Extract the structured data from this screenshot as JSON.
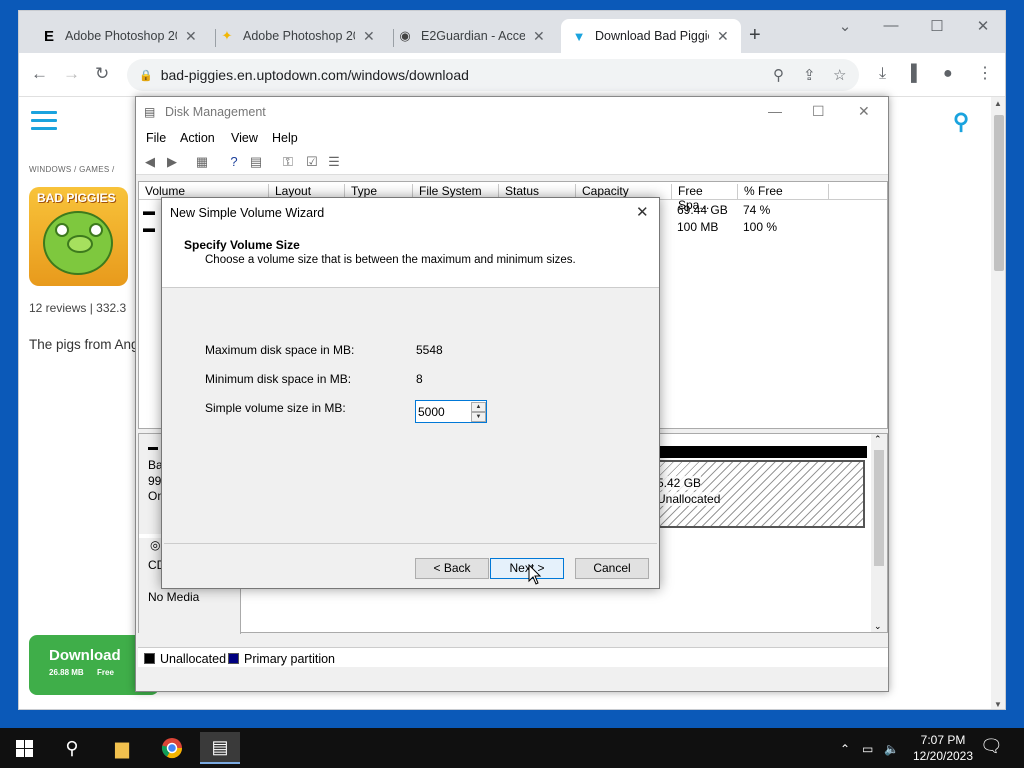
{
  "browser": {
    "tabs": [
      {
        "label": "Adobe Photoshop 20",
        "icon": "tech-site-icon"
      },
      {
        "label": "Adobe Photoshop 20",
        "icon": "photoshop-app-icon"
      },
      {
        "label": "E2Guardian - Access",
        "icon": "globe-icon"
      },
      {
        "label": "Download Bad Piggie",
        "icon": "uptodown-icon"
      }
    ],
    "url": "bad-piggies.en.uptodown.com/windows/download"
  },
  "page": {
    "breadcrumb": "WINDOWS  /  GAMES  /",
    "app_logo_text": "BAD PIGGIES",
    "reviews": "12 reviews  |  332.3",
    "description": "The pigs from Ang",
    "download_label": "Download",
    "download_size": "26.88 MB",
    "download_free": "Free",
    "footer_text": ""
  },
  "disk_management": {
    "title": "Disk Management",
    "menu": [
      "File",
      "Action",
      "View",
      "Help"
    ],
    "columns": [
      "Volume",
      "Layout",
      "Type",
      "File System",
      "Status",
      "Capacity",
      "Free Spa...",
      "% Free"
    ],
    "rows": [
      {
        "free": "69.44 GB",
        "pct": "74 %"
      },
      {
        "free": "100 MB",
        "pct": "100 %"
      }
    ],
    "disk0": {
      "line1": "Ba",
      "line2": "99.",
      "line3": "On"
    },
    "cd": {
      "label": "CD",
      "media": "No Media"
    },
    "unallocated": {
      "size": "5.42 GB",
      "label": "Unallocated"
    },
    "legend": [
      {
        "label": "Unallocated",
        "color": "#000000"
      },
      {
        "label": "Primary partition",
        "color": "#000080"
      }
    ]
  },
  "wizard": {
    "title": "New Simple Volume Wizard",
    "heading": "Specify Volume Size",
    "subheading": "Choose a volume size that is between the maximum and minimum sizes.",
    "max_label": "Maximum disk space in MB:",
    "max_value": "5548",
    "min_label": "Minimum disk space in MB:",
    "min_value": "8",
    "size_label": "Simple volume size in MB:",
    "size_value": "5000",
    "back": "< Back",
    "next": "Next >",
    "cancel": "Cancel"
  },
  "taskbar": {
    "time": "7:07 PM",
    "date": "12/20/2023"
  }
}
